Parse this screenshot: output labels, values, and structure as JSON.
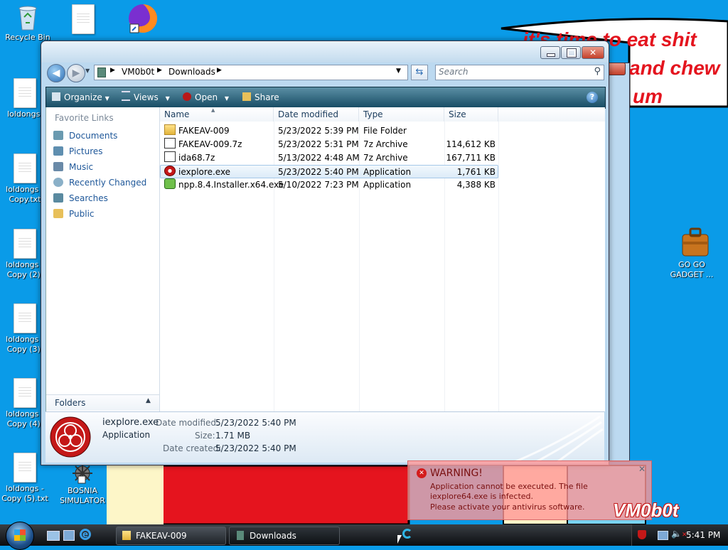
{
  "desktop": {
    "banner_lines": [
      "it's time to eat shit",
      "and chew",
      "um"
    ],
    "icons": [
      {
        "label": "Recycle Bin",
        "icon": "recycle-bin-icon"
      },
      {
        "label": "",
        "icon": "document-icon"
      },
      {
        "label": "",
        "icon": "firefox-icon"
      },
      {
        "label": "loldongs.",
        "icon": "document-icon"
      },
      {
        "label": "loldongs - Copy.txt",
        "icon": "document-icon"
      },
      {
        "label": "loldongs - Copy (2).",
        "icon": "document-icon"
      },
      {
        "label": "loldongs - Copy (3).",
        "icon": "document-icon"
      },
      {
        "label": "loldongs - Copy (4).",
        "icon": "document-icon"
      },
      {
        "label": "loldongs - Copy (5).txt",
        "icon": "document-icon"
      },
      {
        "label": "BOSNIA SIMULATOR",
        "icon": "bosnia-simulator-icon"
      },
      {
        "label": "GO GO GADGET ...",
        "icon": "briefcase-icon"
      }
    ],
    "watermark": "VM0b0t"
  },
  "explorer": {
    "address": {
      "crumbs": [
        "VM0b0t",
        "Downloads"
      ],
      "search_placeholder": "Search"
    },
    "toolbar": {
      "organize": "Organize",
      "views": "Views",
      "open": "Open",
      "share": "Share"
    },
    "nav": {
      "header": "Favorite Links",
      "links": [
        "Documents",
        "Pictures",
        "Music",
        "Recently Changed",
        "Searches",
        "Public"
      ],
      "folders_label": "Folders"
    },
    "columns": [
      "Name",
      "Date modified",
      "Type",
      "Size"
    ],
    "files": [
      {
        "name": "FAKEAV-009",
        "date": "5/23/2022 5:39 PM",
        "type": "File Folder",
        "size": "",
        "icon": "folder-icon"
      },
      {
        "name": "FAKEAV-009.7z",
        "date": "5/23/2022 5:31 PM",
        "type": "7z Archive",
        "size": "114,612 KB",
        "icon": "archive-icon"
      },
      {
        "name": "ida68.7z",
        "date": "5/13/2022 4:48 AM",
        "type": "7z Archive",
        "size": "167,711 KB",
        "icon": "archive-icon"
      },
      {
        "name": "iexplore.exe",
        "date": "5/23/2022 5:40 PM",
        "type": "Application",
        "size": "1,761 KB",
        "icon": "biohazard-icon"
      },
      {
        "name": "npp.8.4.Installer.x64.exe",
        "date": "5/10/2022 7:23 PM",
        "type": "Application",
        "size": "4,388 KB",
        "icon": "installer-icon"
      }
    ],
    "details": {
      "name": "iexplore.exe",
      "kind": "Application",
      "modified_label": "Date modified:",
      "modified": "5/23/2022 5:40 PM",
      "size_label": "Size:",
      "size": "1.71 MB",
      "created_label": "Date created:",
      "created": "5/23/2022 5:40 PM"
    }
  },
  "toast": {
    "title": "WARNING!",
    "line1": "Application cannot be executed. The file iexplore64.exe is infected.",
    "line2": "Please activate your antivirus software."
  },
  "taskbar": {
    "buttons": [
      "FAKEAV-009",
      "Downloads"
    ],
    "clock": "5:41 PM"
  }
}
